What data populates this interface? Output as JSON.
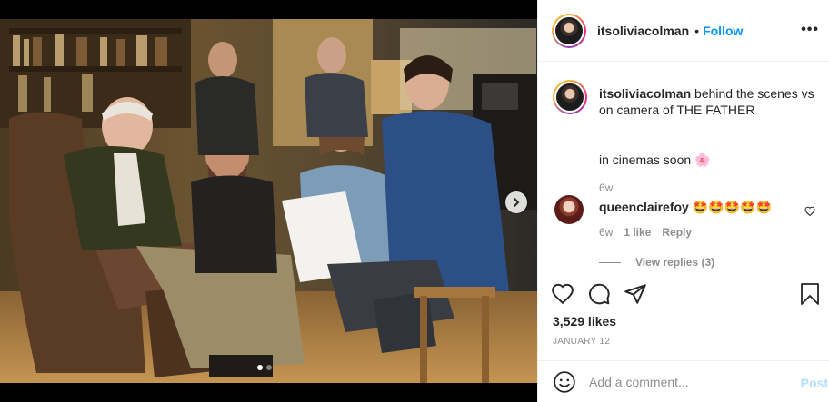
{
  "header": {
    "username": "itsoliviacolman",
    "separator": "•",
    "follow_label": "Follow",
    "more_label": "•••"
  },
  "caption": {
    "username": "itsoliviacolman",
    "text": "behind the scenes vs on camera of THE FATHER",
    "extra": "in cinemas soon 🌸",
    "time": "6w"
  },
  "comment": {
    "username": "queenclairefoy",
    "text": "🤩🤩🤩🤩🤩",
    "time": "6w",
    "likes": "1 like",
    "reply_label": "Reply",
    "view_replies": "View replies (3)"
  },
  "post": {
    "likes": "3,529 likes",
    "date": "JANUARY 12",
    "carousel_count": 2,
    "carousel_active": 1
  },
  "add_comment": {
    "placeholder": "Add a comment...",
    "post_label": "Post"
  },
  "colors": {
    "link": "#0095f6",
    "post_disabled": "#b2dffc",
    "muted": "#8e8e8e"
  },
  "icons": [
    "heart-icon",
    "comment-icon",
    "share-icon",
    "bookmark-icon",
    "emoji-icon",
    "chevron-right-icon",
    "more-icon"
  ]
}
